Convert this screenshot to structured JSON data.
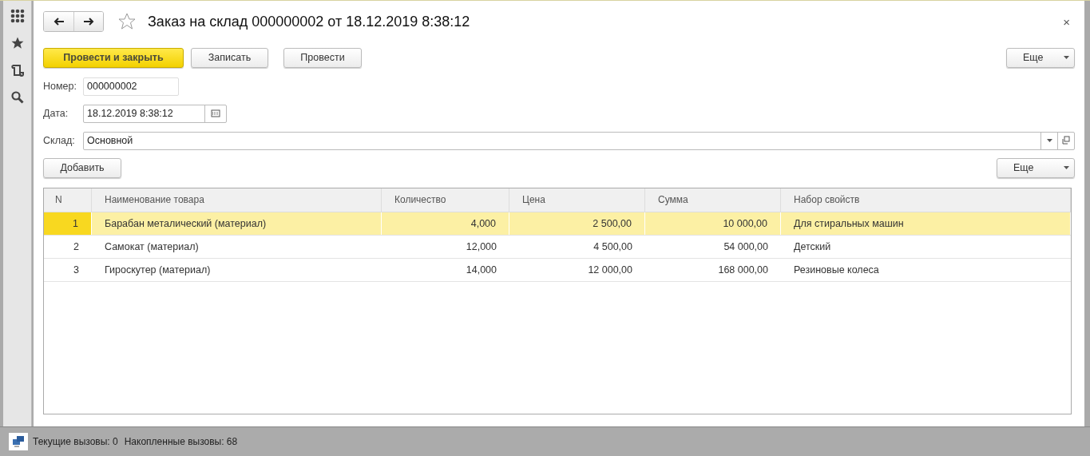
{
  "window": {
    "title": "Заказ на склад 000000002 от 18.12.2019 8:38:12",
    "close": "×"
  },
  "commands": [
    {
      "label": "Провести и закрыть",
      "kind": "default"
    },
    {
      "label": "Записать",
      "kind": "normal"
    },
    {
      "label": "Провести",
      "kind": "normal"
    }
  ],
  "more_button": "Еще",
  "fields": [
    {
      "label": "Номер:",
      "value": "000000002",
      "kind": "text"
    },
    {
      "label": "Дата:",
      "value": "18.12.2019  8:38:12",
      "kind": "date"
    },
    {
      "label": "Склад:",
      "value": "Основной",
      "kind": "select"
    }
  ],
  "table_toolbar": {
    "add_button": "Добавить",
    "more_button": "Еще"
  },
  "table": {
    "columns": [
      "N",
      "Наименование товара",
      "Количество",
      "Цена",
      "Сумма",
      "Набор свойств"
    ],
    "rows": [
      {
        "cells": [
          "1",
          "Барабан металический (материал)",
          "4,000",
          "2 500,00",
          "10 000,00",
          "Для стиральных машин"
        ],
        "selected": true
      },
      {
        "cells": [
          "2",
          "Самокат (материал)",
          "12,000",
          "4 500,00",
          "54 000,00",
          "Детский"
        ],
        "selected": false
      },
      {
        "cells": [
          "3",
          "Гироскутер (материал)",
          "14,000",
          "12 000,00",
          "168 000,00",
          "Резиновые колеса"
        ],
        "selected": false
      }
    ]
  },
  "status_bar": {
    "current_calls": "Текущие вызовы: 0",
    "accumulated_calls": "Накопленные вызовы: 68"
  }
}
